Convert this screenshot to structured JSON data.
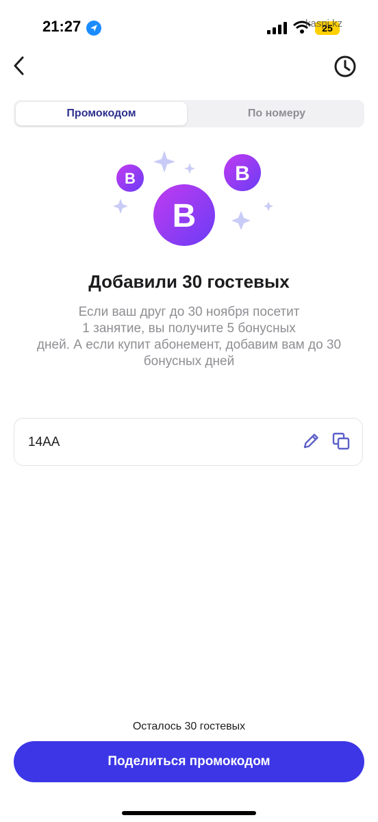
{
  "status_bar": {
    "time": "21:27",
    "battery": "25",
    "watermark": "kaspi.kz",
    "icons": [
      "location-arrow-icon",
      "signal-icon",
      "wifi-icon",
      "battery-icon"
    ]
  },
  "header": {
    "back_icon": "chevron-left-icon",
    "history_icon": "clock-icon"
  },
  "tabs": [
    {
      "label": "Промокодом",
      "active": true
    },
    {
      "label": "По номеру",
      "active": false
    }
  ],
  "hero": {
    "badge_letter": "B",
    "colors": {
      "gradient_start": "#c13bf0",
      "gradient_end": "#6a3cf5",
      "sparkle": "#c9cbf7"
    }
  },
  "headline": "Добавили 30 гостевых",
  "description_lines": [
    "Если ваш друг до 30 ноября посетит",
    "1 занятие, вы получите 5 бонусных",
    "дней. А если купит абонемент, добавим вам до 30",
    "бонусных дней"
  ],
  "promo": {
    "code": "14АА",
    "edit_icon": "pencil-icon",
    "copy_icon": "copy-icon"
  },
  "footer": {
    "remaining_text": "Осталось 30 гостевых",
    "share_label": "Поделиться промокодом",
    "accent_color": "#3c36e6"
  }
}
